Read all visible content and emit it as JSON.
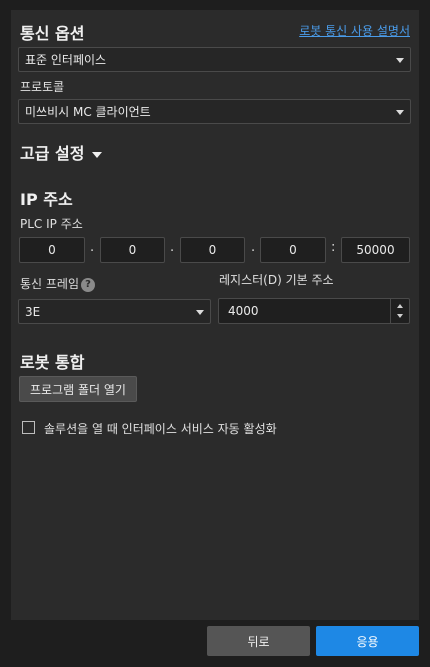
{
  "comm": {
    "title": "통신 옵션",
    "manual_link": "로봇 통신 사용 설명서",
    "interface_value": "표준 인터페이스",
    "protocol_label": "프로토콜",
    "protocol_value": "미쓰비시 MC 클라이언트"
  },
  "advanced": {
    "title": "고급 설정"
  },
  "ip": {
    "title": "IP 주소",
    "plc_label": "PLC IP 주소",
    "octets": [
      "0",
      "0",
      "0",
      "0"
    ],
    "port": "50000"
  },
  "frame": {
    "label": "통신 프레임",
    "help": "?",
    "value": "3E"
  },
  "register": {
    "label": "레지스터(D) 기본 주소",
    "value": "4000"
  },
  "robot": {
    "title": "로봇 통합",
    "open_folder": "프로그램 폴더 열기",
    "auto_activate_label": "솔루션을 열 때 인터페이스 서비스 자동 활성화",
    "auto_activate_checked": false
  },
  "footer": {
    "back": "뒤로",
    "apply": "응용"
  },
  "colors": {
    "accent": "#1e88e5",
    "link": "#4a9be8",
    "panel": "#2b2b2b",
    "background": "#1e1e1e"
  }
}
